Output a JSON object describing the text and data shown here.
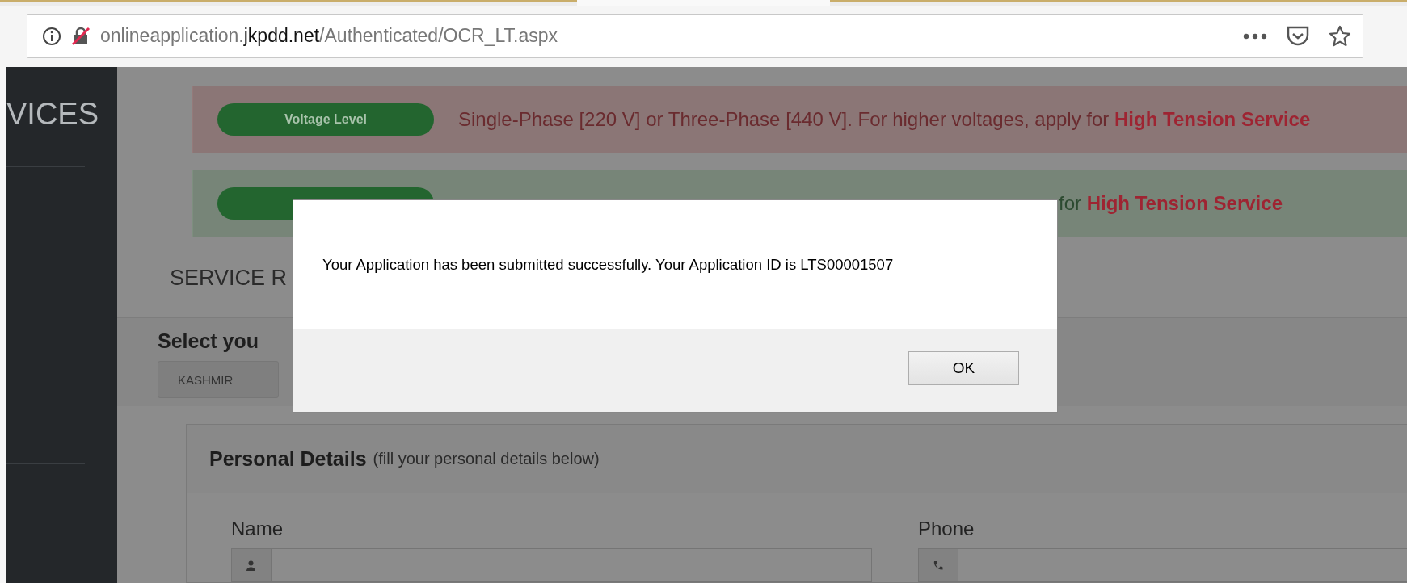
{
  "browser_tabs": [
    {
      "selected": false
    },
    {
      "selected": false
    },
    {
      "selected": true
    },
    {
      "selected": false
    },
    {
      "selected": false
    }
  ],
  "browser": {
    "url_prefix": "onlineapplication.",
    "url_domain": "jkpdd.net",
    "url_path": "/Authenticated/OCR_LT.aspx"
  },
  "sidebar": {
    "title": "VICES"
  },
  "alerts": [
    {
      "kind": "danger",
      "pill": "Voltage Level",
      "text": "Single-Phase [220 V] or Three-Phase [440 V]. For higher voltages, apply for **High Tension Service**"
    },
    {
      "kind": "success",
      "text": "for **High Tension Service**"
    }
  ],
  "section_title": "SERVICE R",
  "select": {
    "label": "Select you",
    "value": "KASHMIR"
  },
  "panel": {
    "title": "Personal Details",
    "subtitle": "(fill your personal details below)",
    "fields": [
      {
        "label": "Name"
      },
      {
        "label": "Phone"
      }
    ]
  },
  "dialog": {
    "message": "Your Application has been submitted successfully. Your Application ID is LTS00001507",
    "button": "OK"
  }
}
